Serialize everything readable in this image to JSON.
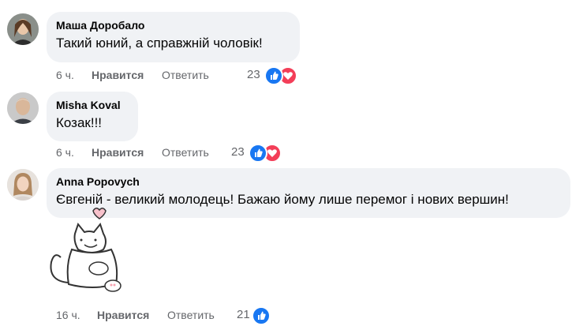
{
  "comments": [
    {
      "author": "Маша Доробало",
      "text": "Такий юний, а справжній чоловік!",
      "time": "6 ч.",
      "like_label": "Нравится",
      "reply_label": "Ответить",
      "reaction_count": "23",
      "reactions": [
        "like-icon",
        "love-icon"
      ]
    },
    {
      "author": "Misha Koval",
      "text": "Козак!!!",
      "time": "6 ч.",
      "like_label": "Нравится",
      "reply_label": "Ответить",
      "reaction_count": "23",
      "reactions": [
        "like-icon",
        "love-icon"
      ]
    },
    {
      "author": "Anna Popovych",
      "text": "Євгеній - великий молодець! Бажаю йому лише перемог і нових вершин!",
      "time": "16 ч.",
      "like_label": "Нравится",
      "reply_label": "Ответить",
      "reaction_count": "21",
      "reactions": [
        "like-icon"
      ],
      "sticker": "cat-with-heart-sticker"
    }
  ],
  "colors": {
    "bubble_bg": "#f0f2f5",
    "meta_text": "#65676b",
    "like_blue": "#1877f2",
    "love_red": "#f33e58"
  }
}
